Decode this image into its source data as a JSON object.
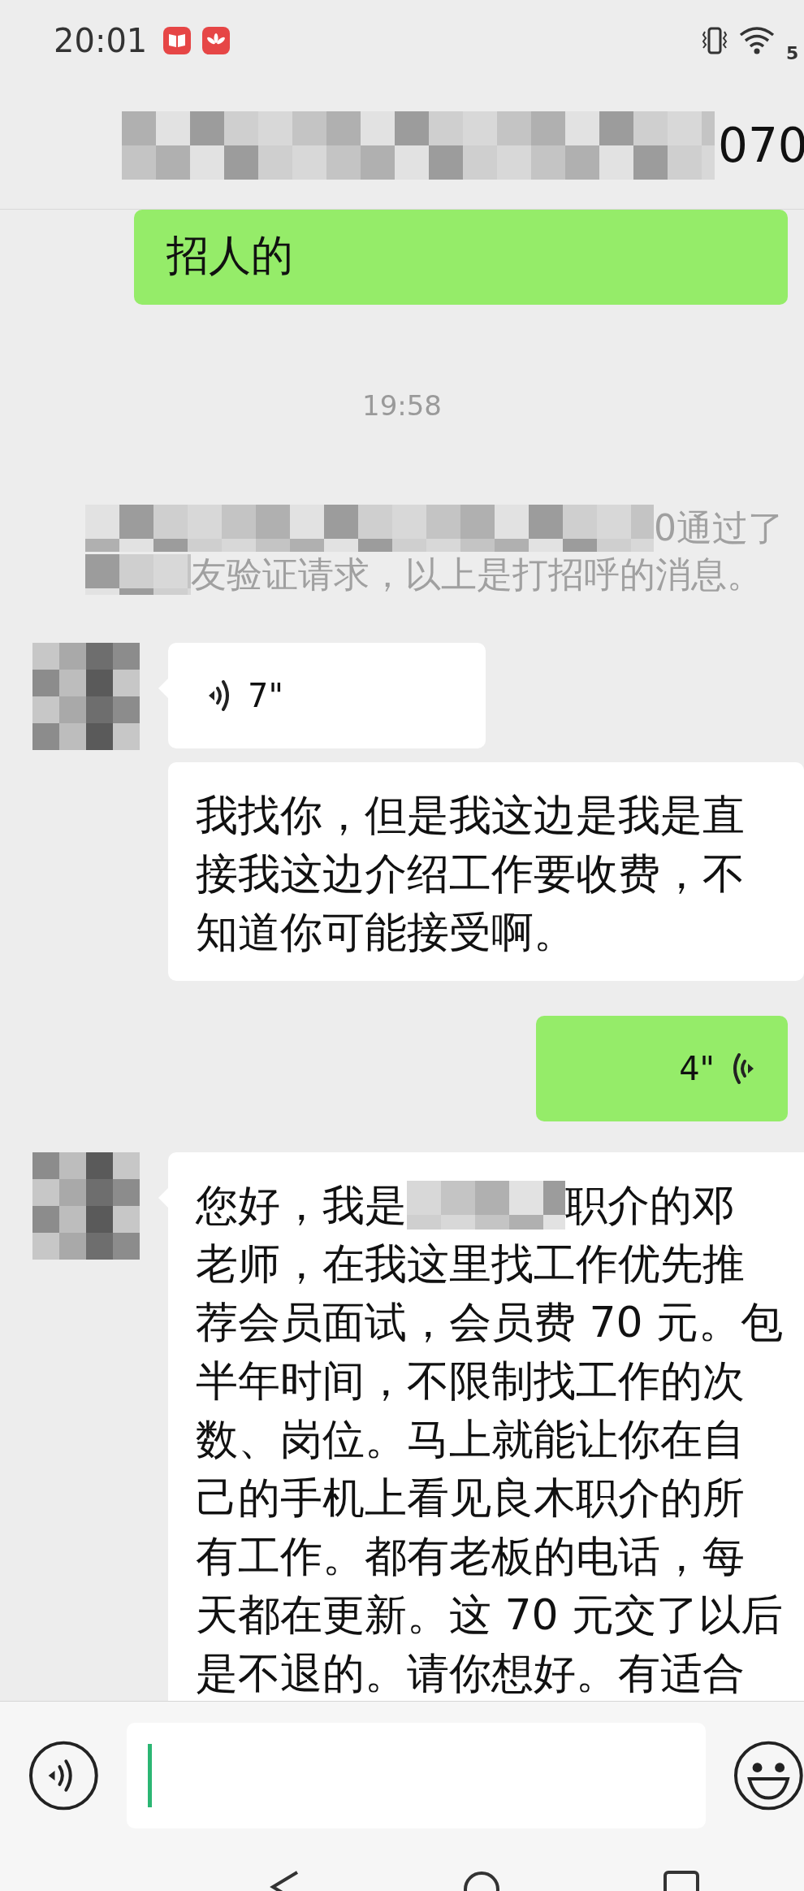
{
  "status_bar": {
    "time": "20:01",
    "network": "5"
  },
  "header": {
    "title": [
      {
        "kind": "mosaic"
      },
      "070"
    ]
  },
  "messages": [
    {
      "kind": "text",
      "outgoing": true,
      "lines": [
        [
          "招人的"
        ]
      ]
    },
    {
      "kind": "time",
      "text": "19:58"
    },
    {
      "kind": "system",
      "lines": [
        [
          {
            "kind": "mosaic"
          },
          "0通过了"
        ],
        [
          {
            "kind": "mosaic"
          },
          "友验证请求，以上是打招呼的消息。"
        ]
      ]
    },
    {
      "kind": "voice",
      "outgoing": false,
      "avatar": true,
      "duration": "7\""
    },
    {
      "kind": "text",
      "outgoing": false,
      "avatar": false,
      "lines": [
        [
          "我找你，但是我这边是我是直"
        ],
        [
          "接我这边介绍工作要收费，不"
        ],
        [
          "知道你可能接受啊。"
        ]
      ]
    },
    {
      "kind": "voice",
      "outgoing": true,
      "duration": "4\""
    },
    {
      "kind": "text",
      "outgoing": false,
      "avatar": true,
      "lines": [
        [
          "您好，我是",
          {
            "kind": "mosaic"
          },
          "职介的邓"
        ],
        [
          "老师，在我这里找工作优先推"
        ],
        [
          "荐会员面试，会员费 70 元。包"
        ],
        [
          "半年时间，不限制找工作的次"
        ],
        [
          "数、岗位。马上就能让你在自"
        ],
        [
          "己的手机上看见良木职介的所"
        ],
        [
          "有工作。都有老板的电话，每"
        ],
        [
          "天都在更新。这 70 元交了以后"
        ],
        [
          "是不退的。请你想好。有适合"
        ]
      ]
    }
  ]
}
